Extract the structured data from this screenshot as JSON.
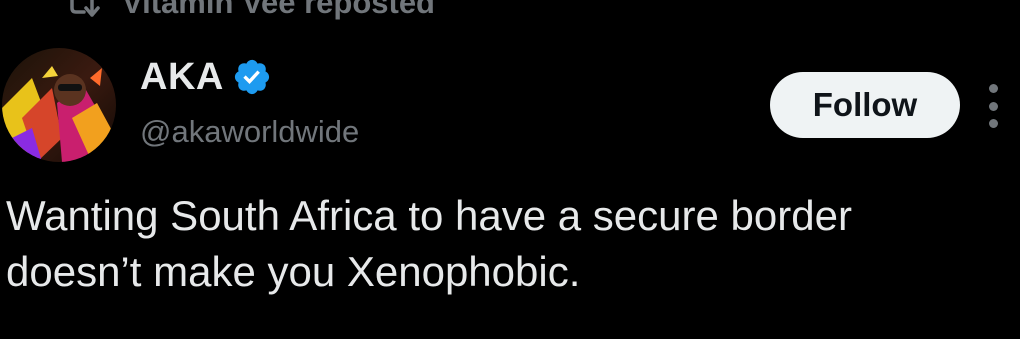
{
  "repost_header": {
    "text": "Vitamin Vee reposted",
    "icon": "repost-icon"
  },
  "tweet": {
    "author": {
      "display_name": "AKA",
      "handle": "@akaworldwide",
      "verified": true,
      "verified_icon": "verified-badge-icon",
      "avatar": "avatar-image"
    },
    "follow_label": "Follow",
    "more_icon": "more-vertical-icon",
    "text_line1": "Wanting South Africa to have a secure border",
    "text_line2": "doesn’t make you Xenophobic."
  },
  "colors": {
    "background": "#000000",
    "primary_text": "#e7e9ea",
    "secondary_text": "#71767b",
    "verified_blue": "#1d9bf0",
    "follow_bg": "#eff3f4",
    "follow_text": "#0f1419"
  }
}
